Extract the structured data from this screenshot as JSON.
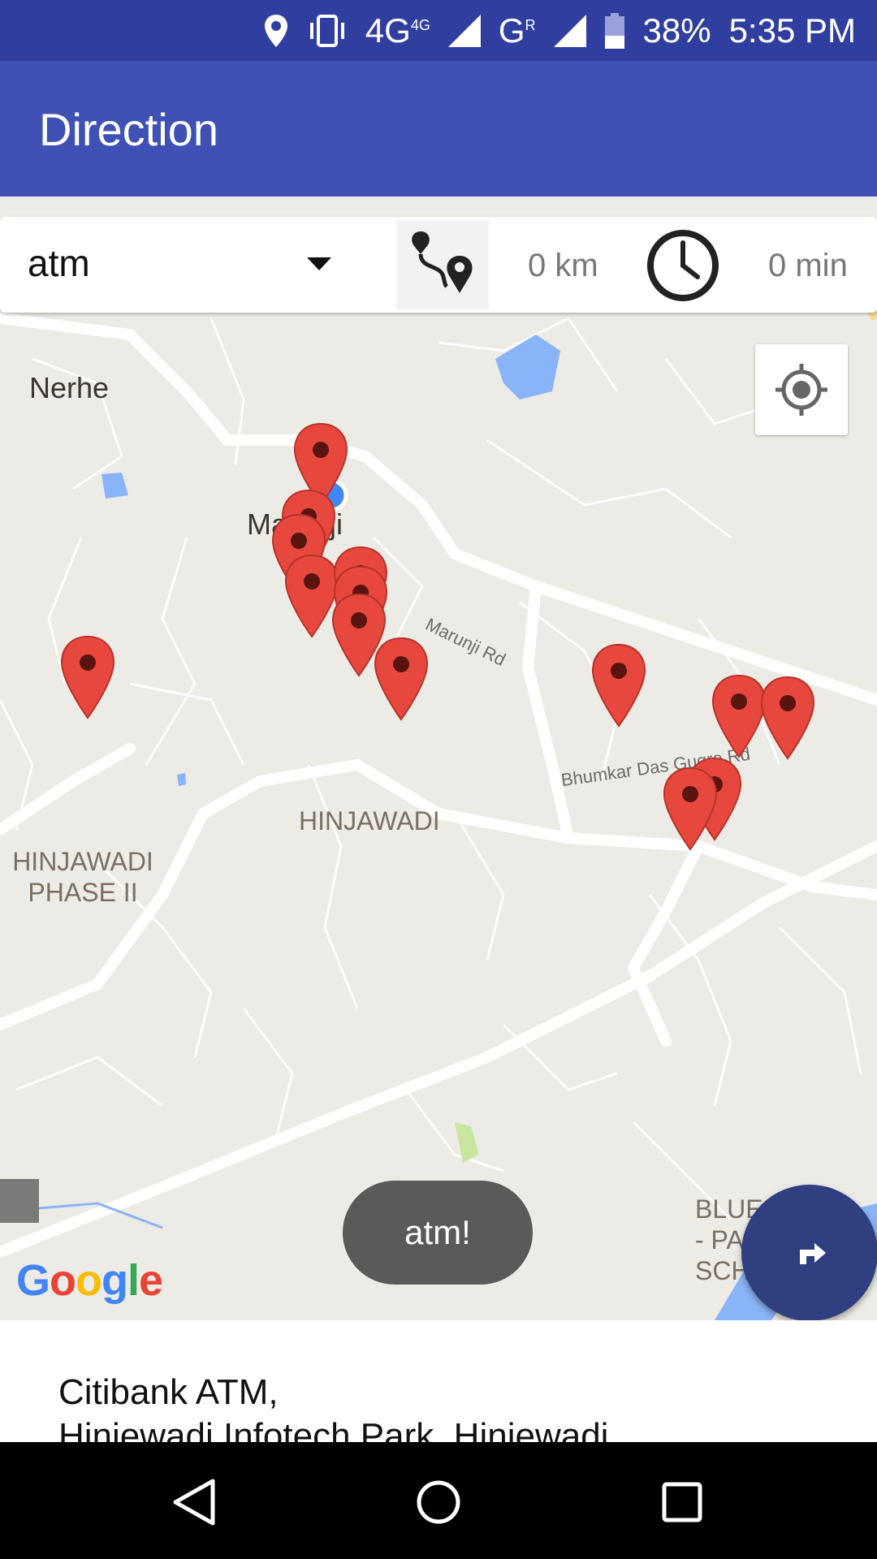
{
  "status_bar": {
    "network_label": "4G",
    "network_sub": "4G",
    "carrier_label": "G",
    "carrier_sub": "R",
    "battery": "38%",
    "time": "5:35 PM",
    "icons": [
      "location-icon",
      "vibrate-icon",
      "signal-icon",
      "battery-icon"
    ]
  },
  "app_bar": {
    "title": "Direction"
  },
  "controls": {
    "place_type": "atm",
    "distance": "0 km",
    "duration": "0 min",
    "icons": [
      "dropdown-arrow-icon",
      "route-icon",
      "clock-icon"
    ]
  },
  "map": {
    "places": {
      "nerhe": "Nerhe",
      "marunji": "Marunji",
      "hinjawadi": "HINJAWADI",
      "hinjawadi_phase2_line1": "HINJAWADI",
      "hinjawadi_phase2_line2": "PHASE II",
      "blue_line1": "BLUE R",
      "blue_line2": "- PAR",
      "blue_line3": "SCH"
    },
    "roads": {
      "marunji_rd": "Marunji Rd",
      "bhumkar_rd": "Bhumkar Das Gugre Rd"
    },
    "marker_count": 14,
    "google_logo": "Google",
    "colors": {
      "marker": "#e8473d",
      "user_location": "#4285f4",
      "water": "#8ab4f8",
      "park": "#c8e6a0"
    }
  },
  "toast": {
    "text": "atm!"
  },
  "details": {
    "address_line1": "Citibank ATM,",
    "address_line2": "Hinjewadi Infotech Park, Hinjewadi"
  },
  "nav_bar": {
    "icons": [
      "back-icon",
      "home-icon",
      "recents-icon"
    ]
  }
}
